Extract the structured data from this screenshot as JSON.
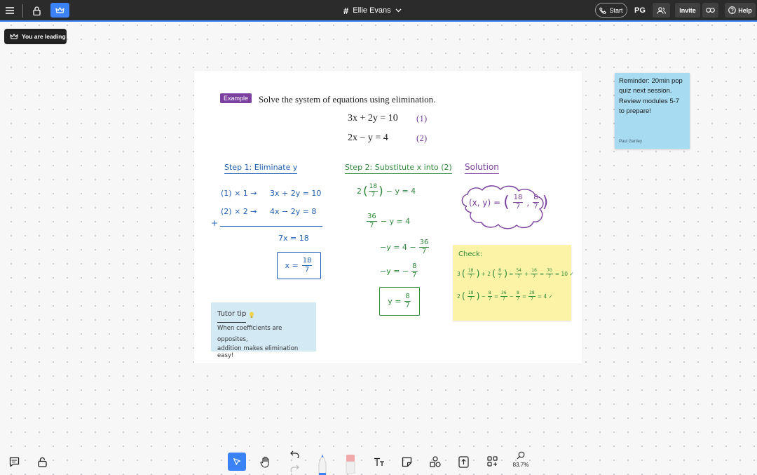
{
  "topbar": {
    "menu_icon": "hamburger-icon",
    "title": "Ellie Evans",
    "title_prefix": "#",
    "start_label": "Start",
    "user_initials": "PG",
    "invite_label": "Invite",
    "help_label": "Help",
    "accent_color": "#3b82f6"
  },
  "leading_badge": "You are leading",
  "lesson": {
    "badge": "Example",
    "prompt": "Solve the system of equations using elimination.",
    "eq1": "3x + 2y = 10",
    "eq1_tag": "(1)",
    "eq2": "2x − y = 4",
    "eq2_tag": "(2)"
  },
  "step1": {
    "heading": "Step 1: Eliminate y",
    "row1_op": "(1) × 1 →",
    "row1_eq": "3x + 2y = 10",
    "row2_op": "(2) × 2 →",
    "row2_eq": "4x − 2y = 8",
    "plus": "+",
    "sum": "7x = 18",
    "result_lhs": "x =",
    "result_num": "18",
    "result_den": "7"
  },
  "step2": {
    "heading": "Step 2: Substitute x into (2)",
    "line1_pre": "2",
    "line1_num": "18",
    "line1_den": "7",
    "line1_post": "− y = 4",
    "line2_num": "36",
    "line2_den": "7",
    "line2_post": "− y = 4",
    "line3_pre": "−y = 4 −",
    "line3_num": "36",
    "line3_den": "7",
    "line4_pre": "−y = −",
    "line4_num": "8",
    "line4_den": "7",
    "result_lhs": "y =",
    "result_num": "8",
    "result_den": "7"
  },
  "solution": {
    "heading": "Solution",
    "lhs": "(x, y) =",
    "x_num": "18",
    "x_den": "7",
    "y_num": "8",
    "y_den": "7"
  },
  "check": {
    "heading": "Check:",
    "line1_a": "3",
    "line1_b": "+ 2",
    "line1_c": "=",
    "line1_d": "+",
    "line1_e": "=",
    "line1_end": "= 10 ✓",
    "line1_fracs": [
      "18",
      "7",
      "8",
      "7",
      "54",
      "7",
      "16",
      "7",
      "70",
      "7"
    ],
    "line2_a": "2",
    "line2_b": "−",
    "line2_c": "=",
    "line2_d": "−",
    "line2_e": "=",
    "line2_end": "= 4 ✓",
    "line2_fracs": [
      "18",
      "7",
      "8",
      "7",
      "36",
      "7",
      "8",
      "7",
      "28",
      "7"
    ]
  },
  "tutor_tip": {
    "title": "Tutor tip",
    "line1": "When coefficients are opposites,",
    "line2": "addition makes elimination easy!"
  },
  "sticky_note": {
    "text": "Reminder: 20min pop quiz next session. Review modules 5-7 to prepare!",
    "author": "Paul Gartley"
  },
  "bottom": {
    "zoom": "83.7%"
  }
}
